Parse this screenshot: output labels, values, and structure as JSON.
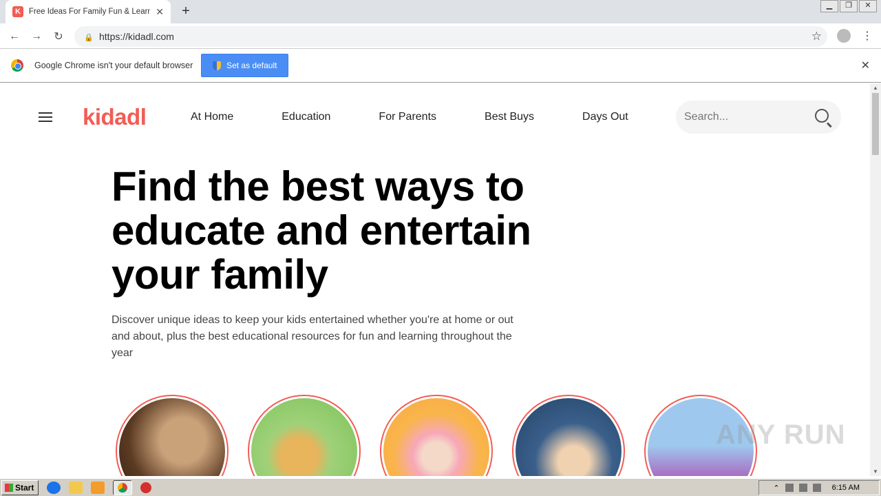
{
  "browser": {
    "tab_title": "Free Ideas For Family Fun & Learning",
    "tab_favicon": "K",
    "url": "https://kidadl.com",
    "infobar_message": "Google Chrome isn't your default browser",
    "set_default_label": "Set as default"
  },
  "site": {
    "logo": "kidadl",
    "brand_color": "#f25c54",
    "nav": [
      "At Home",
      "Education",
      "For Parents",
      "Best Buys",
      "Days Out"
    ],
    "search_placeholder": "Search..."
  },
  "hero": {
    "heading": "Find the best ways to educate and entertain your family",
    "lead": "Discover unique ideas to keep your kids entertained whether you're at home or out and about, plus the best educational resources for fun and learning throughout the year"
  },
  "watermark": "ANY RUN",
  "taskbar": {
    "start_label": "Start",
    "clock": "6:15 AM"
  }
}
